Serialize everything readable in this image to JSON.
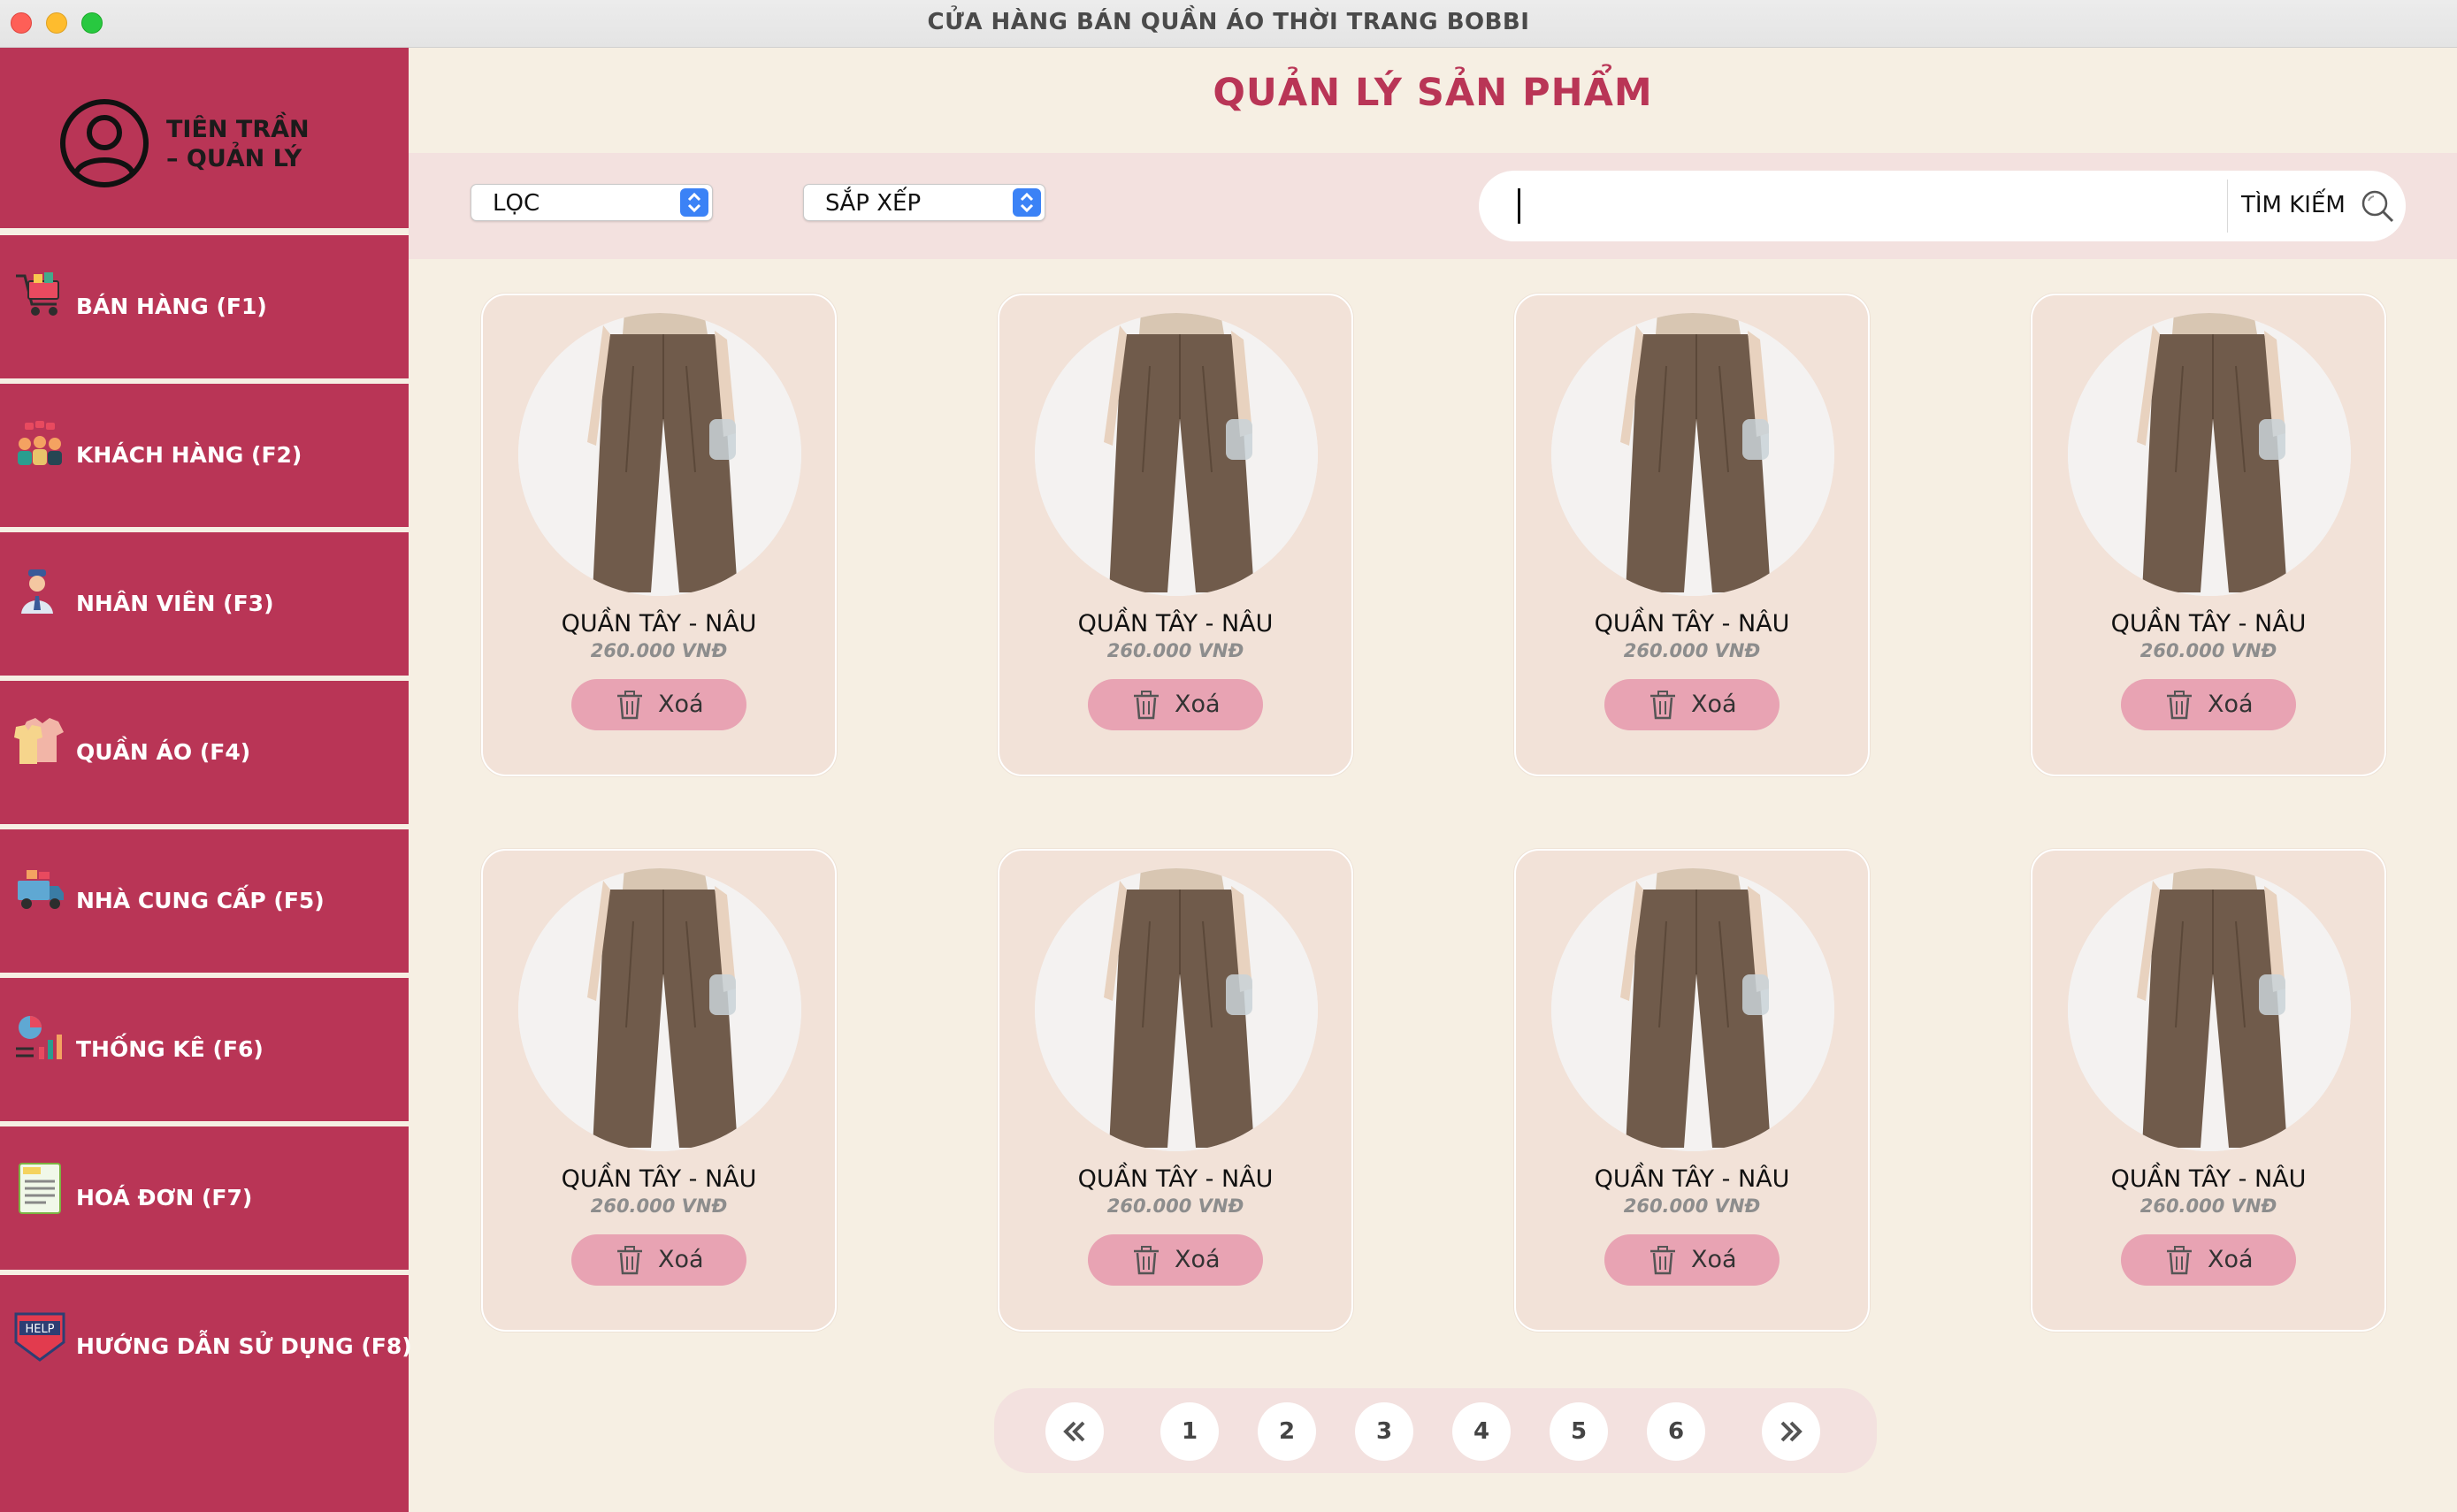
{
  "window": {
    "title": "CỬA HÀNG BÁN QUẦN ÁO THỜI TRANG BOBBI"
  },
  "user": {
    "name": "TIÊN TRẦN\n– QUẢN LÝ",
    "line1": "TIÊN TRẦN",
    "line2": "– QUẢN LÝ"
  },
  "sidebar": {
    "items": [
      {
        "label": "BÁN HÀNG (F1)",
        "icon": "shopping-cart-icon"
      },
      {
        "label": "KHÁCH HÀNG (F2)",
        "icon": "customers-icon"
      },
      {
        "label": "NHÂN VIÊN (F3)",
        "icon": "employee-icon"
      },
      {
        "label": "QUẦN ÁO (F4)",
        "icon": "clothes-icon"
      },
      {
        "label": "NHÀ CUNG CẤP (F5)",
        "icon": "supplier-truck-icon"
      },
      {
        "label": "THỐNG KÊ (F6)",
        "icon": "statistics-icon"
      },
      {
        "label": "HOÁ ĐƠN (F7)",
        "icon": "bill-icon"
      },
      {
        "label": "HƯỚNG DẪN SỬ DỤNG (F8)",
        "icon": "help-icon"
      }
    ]
  },
  "main": {
    "title": "QUẢN LÝ SẢN PHẨM",
    "filter": {
      "value": "LỌC"
    },
    "sort": {
      "value": "SẮP XẾP"
    },
    "search": {
      "value": "",
      "button_label": "TÌM KIẾM"
    }
  },
  "products": [
    {
      "name": "QUẦN TÂY - NÂU",
      "price": "260.000 VNĐ",
      "delete_label": "Xoá"
    },
    {
      "name": "QUẦN TÂY - NÂU",
      "price": "260.000 VNĐ",
      "delete_label": "Xoá"
    },
    {
      "name": "QUẦN TÂY - NÂU",
      "price": "260.000 VNĐ",
      "delete_label": "Xoá"
    },
    {
      "name": "QUẦN TÂY - NÂU",
      "price": "260.000 VNĐ",
      "delete_label": "Xoá"
    },
    {
      "name": "QUẦN TÂY - NÂU",
      "price": "260.000 VNĐ",
      "delete_label": "Xoá"
    },
    {
      "name": "QUẦN TÂY - NÂU",
      "price": "260.000 VNĐ",
      "delete_label": "Xoá"
    },
    {
      "name": "QUẦN TÂY - NÂU",
      "price": "260.000 VNĐ",
      "delete_label": "Xoá"
    },
    {
      "name": "QUẦN TÂY - NÂU",
      "price": "260.000 VNĐ",
      "delete_label": "Xoá"
    }
  ],
  "pagination": {
    "pages": [
      "1",
      "2",
      "3",
      "4",
      "5",
      "6"
    ]
  },
  "colors": {
    "accent": "#b93556",
    "background": "#f6efe3",
    "card": "#f2e2d8",
    "delete_button": "#e8a3b3"
  }
}
